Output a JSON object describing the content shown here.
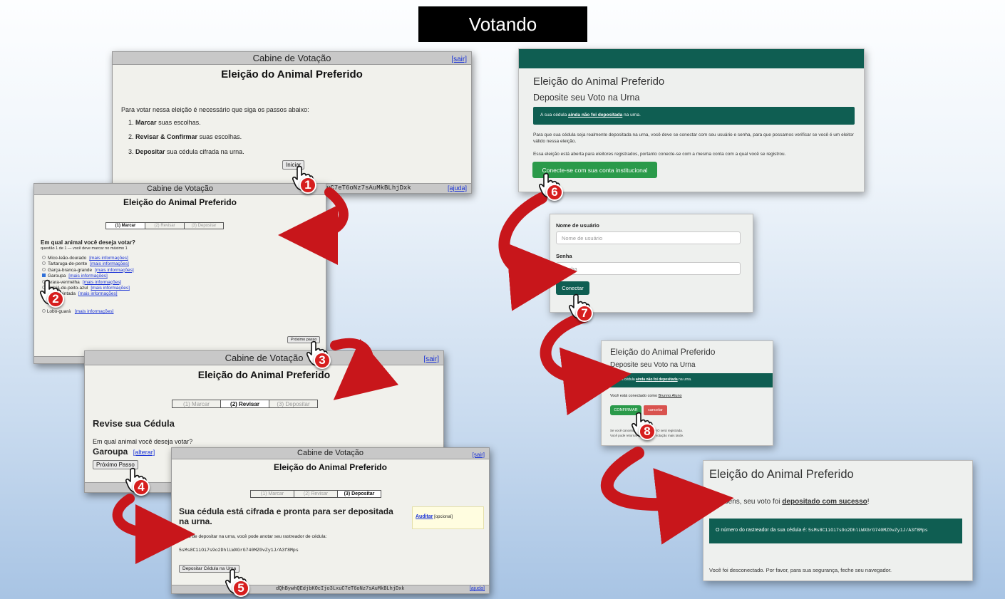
{
  "header": {
    "title": "Votando"
  },
  "booth": {
    "header_label": "Cabine de Votação",
    "sair_label": "[sair]",
    "election_name": "Eleição do Animal Preferido",
    "ajuda_label": "[ajuda]",
    "tracker_hash_partial": "uC7eT6oNz7sAuMkBLhjDxk",
    "tracker_hash_footer": "dQhBywhQEdjbKOcIjo3LxuC7eT6oNz7sAuMkBLhjDxk"
  },
  "screen1": {
    "intro": "Para votar nessa eleição é necessário que siga os passos abaixo:",
    "steps": [
      {
        "num": "1.",
        "bold": "Marcar",
        "rest": " suas escolhas."
      },
      {
        "num": "2.",
        "bold": "Revisar & Confirmar",
        "rest": " suas escolhas."
      },
      {
        "num": "3.",
        "bold": "Depositar",
        "rest": " sua cédula cifrada na urna."
      }
    ],
    "start_button": "Iniciar"
  },
  "step_tabs": [
    "(1) Marcar",
    "(2) Revisar",
    "(3) Depositar"
  ],
  "screen2": {
    "question": "Em qual animal você deseja votar?",
    "question_note": "questão 1 de 1 — você deve marcar no máximo 1",
    "info_link": "[mais informações]",
    "options": [
      {
        "label": "Mico-leão-dourado",
        "checked": false
      },
      {
        "label": "Tartaruga-de-pente",
        "checked": false
      },
      {
        "label": "Garça-branca-grande",
        "checked": false
      },
      {
        "label": "Garoupa",
        "checked": true
      },
      {
        "label": "Arara-vermelha",
        "checked": false
      },
      {
        "label": "Sabiá-de-peito-azul",
        "checked": false
      },
      {
        "label": "Onça-pintada",
        "checked": false
      },
      {
        "label": "Lobo-guará",
        "checked": false
      }
    ],
    "next_button": "Próximo passo"
  },
  "screen3": {
    "heading": "Revise sua Cédula",
    "question": "Em qual animal você deseja votar?",
    "answer": "Garoupa",
    "change_link": "[alterar]",
    "next_button": "Próximo Passo"
  },
  "screen5": {
    "heading": "Sua cédula está cifrada e pronta para ser depositada na urna.",
    "note": "Antes de depositar na urna, você pode anotar seu rastreador de cédula:",
    "tracker": "5sMs8C1iOi7s9o2DhlLWXGrG740MZ0vZy1J/A3f8Mps",
    "deposit_button": "Depositar Cédula na Urna",
    "audit_link": "Auditar",
    "audit_note": "[opcional]"
  },
  "screen6": {
    "election_name": "Eleição do Animal Preferido",
    "subtitle": "Deposite seu Voto na Urna",
    "alert_pre": "A sua cédula ",
    "alert_strong": "ainda não foi depositada",
    "alert_post": " na urna.",
    "para1": "Para que sua cédula seja realmente depositada na urna, você deve se conectar com seu usuário e senha, para que possamos verificar se você é um eleitor válido nessa eleição.",
    "para2": "Essa eleição está aberta para eleitores registrados, portanto conecte-se com a mesma conta com a qual você se registrou.",
    "login_button": "Conecte-se com sua conta institucional"
  },
  "screen7": {
    "username_label": "Nome de usuário",
    "username_placeholder": "Nome de usuário",
    "password_label": "Senha",
    "password_placeholder": "Senha",
    "connect_button": "Conectar"
  },
  "screen8": {
    "connected_as": "Você está conectado como",
    "user_name": "Brunno Aluno",
    "confirm_button": "CONFIRMAR",
    "cancel_button": "cancelar",
    "warn1": "Se você cancelar, sua cédula NÃO será registrada.",
    "warn2": "Você pode retornar à cabine de votação mais tarde."
  },
  "screen9": {
    "election_name": "Eleição do Animal Preferido",
    "congrats_pre": "Parabéns, seu voto foi ",
    "congrats_strong": "depositado com sucesso",
    "congrats_post": "!",
    "tracker_label": "O número do rastreador da sua cédula é:",
    "tracker": "5sMs8C1iOi7s9o2DhlLWXGrG740MZ0vZy1J/A3f8Mps",
    "logout_msg": "Você foi desconectado. Por favor, para sua segurança, feche seu navegador."
  },
  "badges": [
    "1",
    "2",
    "3",
    "4",
    "5",
    "6",
    "7",
    "8"
  ],
  "colors": {
    "teal": "#0f5e52",
    "green": "#2a9a4a",
    "red": "#d61e1e",
    "cancel": "#d9534f"
  }
}
